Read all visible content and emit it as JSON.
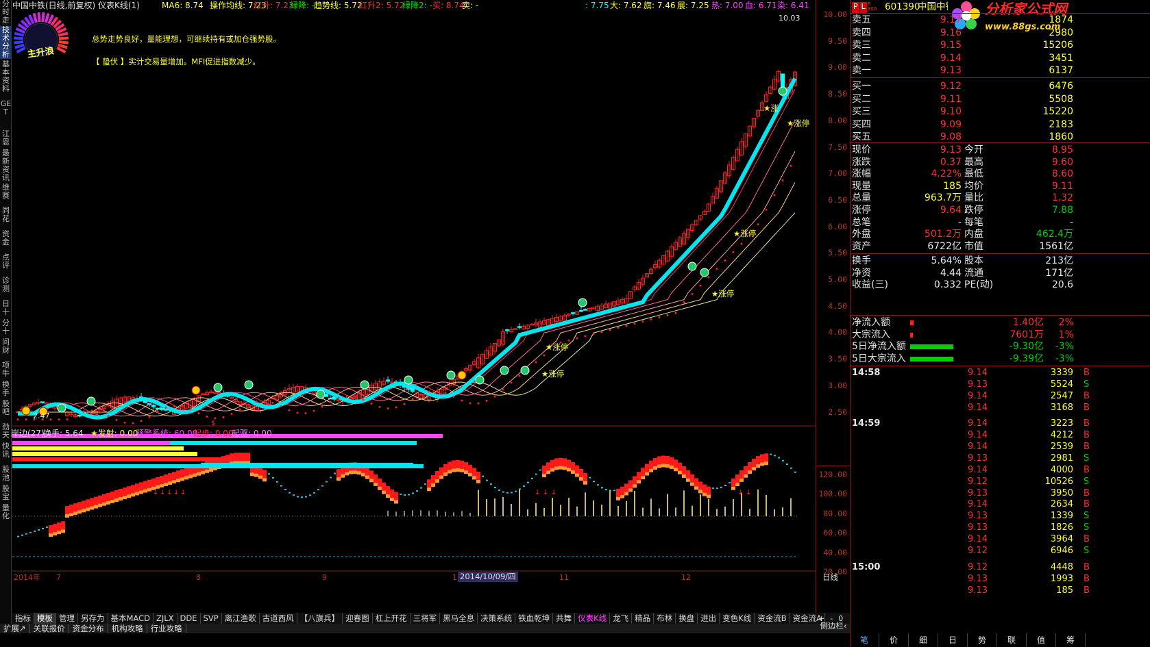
{
  "window": {
    "title": "中国中铁(日线,前复权) 仪表K线(1)"
  },
  "left_sidebar": [
    {
      "label": "分时走势",
      "active": false
    },
    {
      "label": "技术分析",
      "active": true
    },
    {
      "label": "基本资料",
      "active": false
    },
    {
      "label": "GET",
      "active": false
    },
    {
      "label": "江恩",
      "active": false
    },
    {
      "label": "最新资讯",
      "active": false
    },
    {
      "label": "维赛",
      "active": false
    },
    {
      "label": "同花",
      "active": false
    },
    {
      "label": "资金",
      "active": false
    },
    {
      "label": "点评",
      "active": false
    },
    {
      "label": "诊测",
      "active": false
    },
    {
      "label": "日十",
      "active": false
    },
    {
      "label": "分十",
      "active": false
    },
    {
      "label": "问财",
      "active": false
    },
    {
      "label": "项牛",
      "active": false
    },
    {
      "label": "换手",
      "active": false
    },
    {
      "label": "股吧",
      "active": false
    },
    {
      "label": "劲天",
      "active": false
    },
    {
      "label": "快讯",
      "active": false
    },
    {
      "label": "股池",
      "active": false
    },
    {
      "label": "股宝",
      "active": false
    },
    {
      "label": "量化",
      "active": false
    }
  ],
  "indicator_header": {
    "ma6": "MA6: 8.74",
    "czjx": "操作均线: 7.23",
    "hs": "红升: 7.23",
    "lj": "绿降: -",
    "qsx": "趋势线: 5.72",
    "hs2": "红升2: 5.72",
    "lj2": "绿降2: -",
    "mai": "买: 8.74",
    "mai2": "卖: -",
    "v1": ": 7.75",
    "v2": "大: 7.62",
    "v3": "旗: 7.46",
    "v4": "展: 7.25",
    "v5": "热: 7.00",
    "v6": "血: 6.71",
    "v7": "染: 6.41"
  },
  "gauge_label": "主升浪",
  "messages": [
    "总势走势良好，量能理想，可继续持有或加仓强势股。",
    "【 蛰伏 】实计交易量增加。MFI促进指数减少。"
  ],
  "chart_labels": {
    "high_price": "10.03",
    "low_price": "2.47",
    "zt1": "涨停",
    "zt2": "涨停",
    "zt3": "涨停",
    "zt4": "涨停",
    "zt5": "涨停",
    "zt6": "涨停",
    "dollar": "$",
    "star_up": "涨"
  },
  "main_axis": [
    "10.00",
    "9.50",
    "9.00",
    "8.50",
    "8.00",
    "7.50",
    "7.00",
    "6.50",
    "6.00",
    "5.50",
    "5.00",
    "4.50",
    "4.00",
    "3.50",
    "3.00",
    "2.50"
  ],
  "sub_header": {
    "a": "岸边(27)",
    "b": "换手: 5.64",
    "c": "★发射: 0.00",
    "d": "预警系统: 60.00",
    "e": "起步: 0.00",
    "f": "起驱: 0.00"
  },
  "sub_axis": [
    "120.00",
    "100.00",
    "80.00",
    "60.00",
    "40.00",
    "20.00"
  ],
  "x_axis": {
    "labels": [
      "2014年",
      "7",
      "8",
      "9",
      "10",
      "11",
      "12"
    ],
    "cursor_date": "2014/10/09/四",
    "period": "日线"
  },
  "tabs": [
    "指标",
    "模板",
    "管理",
    "另存为",
    "基本MACD",
    "ZJLX",
    "DDE",
    "SVP",
    "离江渔歌",
    "古道西风",
    "【八旗兵】",
    "迎春图",
    "杠上开花",
    "三将军",
    "黑马全息",
    "决策系统",
    "铁血乾坤",
    "共舞",
    "仪表K线",
    "龙飞",
    "精品",
    "布林",
    "换盘",
    "进出",
    "变色K线",
    "资金流B",
    "资金流A"
  ],
  "tab_controls": [
    "+",
    "-",
    "0"
  ],
  "bottom_bar": [
    "扩展↗",
    "关联报价",
    "资金分布",
    "机构攻略",
    "行业攻略"
  ],
  "right_panel": {
    "code": "601390",
    "name": "中国中铁",
    "logo_text": "分析家公式网",
    "logo_url": "www.88gs.com",
    "badge_p": "P",
    "badge_l": "L",
    "badge_r": "R",
    "badge_300": "300",
    "asks": [
      {
        "label": "卖五",
        "price": "9.17",
        "vol": "1874"
      },
      {
        "label": "卖四",
        "price": "9.16",
        "vol": "2980"
      },
      {
        "label": "卖三",
        "price": "9.15",
        "vol": "15206"
      },
      {
        "label": "卖二",
        "price": "9.14",
        "vol": "3451"
      },
      {
        "label": "卖一",
        "price": "9.13",
        "vol": "6137"
      }
    ],
    "bids": [
      {
        "label": "买一",
        "price": "9.12",
        "vol": "6476"
      },
      {
        "label": "买二",
        "price": "9.11",
        "vol": "5508"
      },
      {
        "label": "买三",
        "price": "9.10",
        "vol": "15220"
      },
      {
        "label": "买四",
        "price": "9.09",
        "vol": "2183"
      },
      {
        "label": "买五",
        "price": "9.08",
        "vol": "1860"
      }
    ],
    "quote": [
      {
        "l1": "现价",
        "v1": "9.13",
        "c1": "r",
        "l2": "今开",
        "v2": "8.95",
        "c2": "r"
      },
      {
        "l1": "涨跌",
        "v1": "0.37",
        "c1": "r",
        "l2": "最高",
        "v2": "9.60",
        "c2": "r"
      },
      {
        "l1": "涨幅",
        "v1": "4.22%",
        "c1": "r",
        "l2": "最低",
        "v2": "8.60",
        "c2": "r"
      },
      {
        "l1": "现量",
        "v1": "185",
        "c1": "y",
        "l2": "均价",
        "v2": "9.11",
        "c2": "r"
      },
      {
        "l1": "总量",
        "v1": "963.7万",
        "c1": "y",
        "l2": "量比",
        "v2": "1.32",
        "c2": "r"
      },
      {
        "l1": "涨停",
        "v1": "9.64",
        "c1": "r",
        "l2": "跌停",
        "v2": "7.88",
        "c2": "g"
      },
      {
        "l1": "总笔",
        "v1": "-",
        "c1": "w",
        "l2": "每笔",
        "v2": "-",
        "c2": "w"
      },
      {
        "l1": "外盘",
        "v1": "501.2万",
        "c1": "r",
        "l2": "内盘",
        "v2": "462.4万",
        "c2": "g"
      },
      {
        "l1": "资产",
        "v1": "6722亿",
        "c1": "w",
        "l2": "市值",
        "v2": "1561亿",
        "c2": "w"
      }
    ],
    "stats": [
      {
        "l1": "换手",
        "v1": "5.64%",
        "l2": "股本",
        "v2": "213亿"
      },
      {
        "l1": "净资",
        "v1": "4.44",
        "l2": "流通",
        "v2": "171亿"
      },
      {
        "l1": "收益(三)",
        "v1": "0.332",
        "l2": "PE(动)",
        "v2": "20.6"
      }
    ],
    "flows": [
      {
        "label": "净流入额",
        "value": "1.40亿",
        "pct": "2%",
        "bar": 0.06,
        "color": "r"
      },
      {
        "label": "大宗流入",
        "value": "7601万",
        "pct": "1%",
        "bar": 0.04,
        "color": "r"
      },
      {
        "label": "5日净流入额",
        "value": "-9.30亿",
        "pct": "-3%",
        "bar": 0.7,
        "color": "g"
      },
      {
        "label": "5日大宗流入",
        "value": "-9.39亿",
        "pct": "-3%",
        "bar": 0.7,
        "color": "g"
      }
    ],
    "ticks": [
      {
        "time": "14:58",
        "price": "9.14",
        "vol": "3339",
        "side": "B"
      },
      {
        "time": "",
        "price": "9.13",
        "vol": "5524",
        "side": "S"
      },
      {
        "time": "",
        "price": "9.14",
        "vol": "2547",
        "side": "B"
      },
      {
        "time": "",
        "price": "9.14",
        "vol": "3168",
        "side": "B"
      },
      {
        "time": "14:59",
        "price": "9.14",
        "vol": "3223",
        "side": "B"
      },
      {
        "time": "",
        "price": "9.14",
        "vol": "4212",
        "side": "B"
      },
      {
        "time": "",
        "price": "9.14",
        "vol": "2539",
        "side": "B"
      },
      {
        "time": "",
        "price": "9.13",
        "vol": "2981",
        "side": "S"
      },
      {
        "time": "",
        "price": "9.14",
        "vol": "4000",
        "side": "B"
      },
      {
        "time": "",
        "price": "9.12",
        "vol": "10526",
        "side": "S"
      },
      {
        "time": "",
        "price": "9.13",
        "vol": "3950",
        "side": "B"
      },
      {
        "time": "",
        "price": "9.14",
        "vol": "2634",
        "side": "B"
      },
      {
        "time": "",
        "price": "9.13",
        "vol": "1339",
        "side": "S"
      },
      {
        "time": "",
        "price": "9.13",
        "vol": "1826",
        "side": "S"
      },
      {
        "time": "",
        "price": "9.14",
        "vol": "3964",
        "side": "B"
      },
      {
        "time": "",
        "price": "9.12",
        "vol": "6946",
        "side": "S"
      },
      {
        "time": "15:00",
        "price": "9.12",
        "vol": "4448",
        "side": "B"
      },
      {
        "time": "",
        "price": "9.13",
        "vol": "1993",
        "side": "B"
      },
      {
        "time": "",
        "price": "9.13",
        "vol": "185",
        "side": "B"
      }
    ],
    "bottom_tabs": [
      "笔",
      "价",
      "细",
      "日",
      "势",
      "联",
      "值",
      "筹"
    ],
    "side_label": "侧边栏‹"
  },
  "colors": {
    "up": "#ff2020",
    "down": "#00ffff",
    "axis": "#8a1a1a",
    "ma": "#00e5ee"
  }
}
